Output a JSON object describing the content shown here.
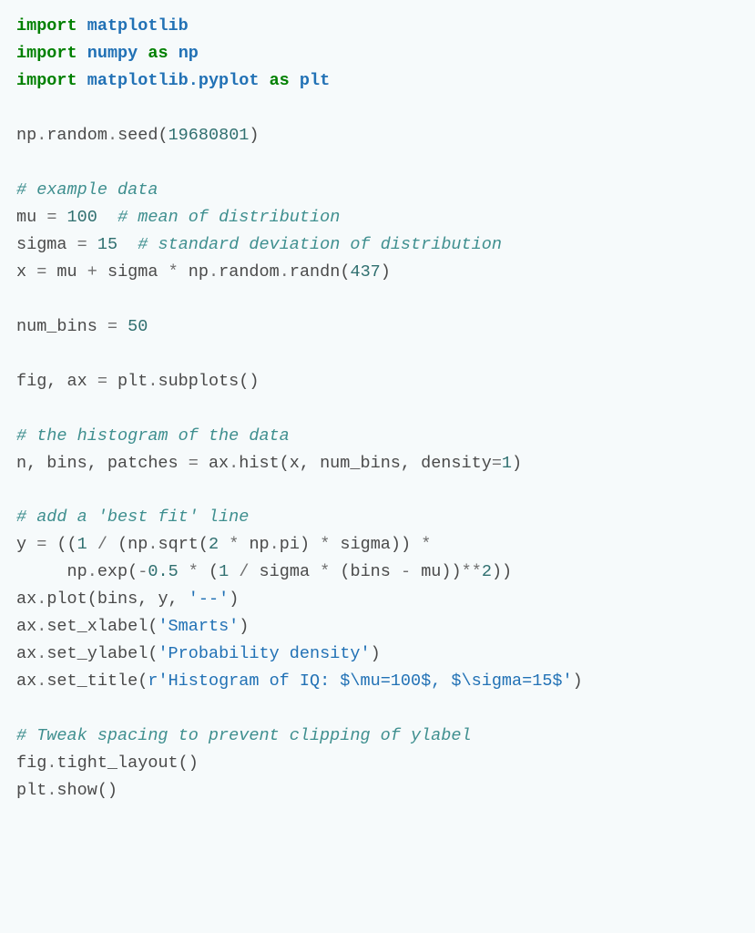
{
  "code": {
    "lines": [
      [
        {
          "t": "import",
          "c": "k"
        },
        {
          "t": " ",
          "c": "n"
        },
        {
          "t": "matplotlib",
          "c": "nn"
        }
      ],
      [
        {
          "t": "import",
          "c": "k"
        },
        {
          "t": " ",
          "c": "n"
        },
        {
          "t": "numpy",
          "c": "nn"
        },
        {
          "t": " ",
          "c": "n"
        },
        {
          "t": "as",
          "c": "k"
        },
        {
          "t": " ",
          "c": "n"
        },
        {
          "t": "np",
          "c": "nn"
        }
      ],
      [
        {
          "t": "import",
          "c": "k"
        },
        {
          "t": " ",
          "c": "n"
        },
        {
          "t": "matplotlib.pyplot",
          "c": "nn"
        },
        {
          "t": " ",
          "c": "n"
        },
        {
          "t": "as",
          "c": "k"
        },
        {
          "t": " ",
          "c": "n"
        },
        {
          "t": "plt",
          "c": "nn"
        }
      ],
      [],
      [
        {
          "t": "np",
          "c": "n"
        },
        {
          "t": ".",
          "c": "o"
        },
        {
          "t": "random",
          "c": "n"
        },
        {
          "t": ".",
          "c": "o"
        },
        {
          "t": "seed(",
          "c": "n"
        },
        {
          "t": "19680801",
          "c": "mi"
        },
        {
          "t": ")",
          "c": "n"
        }
      ],
      [],
      [
        {
          "t": "# example data",
          "c": "c"
        }
      ],
      [
        {
          "t": "mu ",
          "c": "n"
        },
        {
          "t": "=",
          "c": "o"
        },
        {
          "t": " ",
          "c": "n"
        },
        {
          "t": "100",
          "c": "mi"
        },
        {
          "t": "  ",
          "c": "n"
        },
        {
          "t": "# mean of distribution",
          "c": "c"
        }
      ],
      [
        {
          "t": "sigma ",
          "c": "n"
        },
        {
          "t": "=",
          "c": "o"
        },
        {
          "t": " ",
          "c": "n"
        },
        {
          "t": "15",
          "c": "mi"
        },
        {
          "t": "  ",
          "c": "n"
        },
        {
          "t": "# standard deviation of distribution",
          "c": "c"
        }
      ],
      [
        {
          "t": "x ",
          "c": "n"
        },
        {
          "t": "=",
          "c": "o"
        },
        {
          "t": " mu ",
          "c": "n"
        },
        {
          "t": "+",
          "c": "o"
        },
        {
          "t": " sigma ",
          "c": "n"
        },
        {
          "t": "*",
          "c": "o"
        },
        {
          "t": " np",
          "c": "n"
        },
        {
          "t": ".",
          "c": "o"
        },
        {
          "t": "random",
          "c": "n"
        },
        {
          "t": ".",
          "c": "o"
        },
        {
          "t": "randn(",
          "c": "n"
        },
        {
          "t": "437",
          "c": "mi"
        },
        {
          "t": ")",
          "c": "n"
        }
      ],
      [],
      [
        {
          "t": "num_bins ",
          "c": "n"
        },
        {
          "t": "=",
          "c": "o"
        },
        {
          "t": " ",
          "c": "n"
        },
        {
          "t": "50",
          "c": "mi"
        }
      ],
      [],
      [
        {
          "t": "fig, ax ",
          "c": "n"
        },
        {
          "t": "=",
          "c": "o"
        },
        {
          "t": " plt",
          "c": "n"
        },
        {
          "t": ".",
          "c": "o"
        },
        {
          "t": "subplots()",
          "c": "n"
        }
      ],
      [],
      [
        {
          "t": "# the histogram of the data",
          "c": "c"
        }
      ],
      [
        {
          "t": "n, bins, patches ",
          "c": "n"
        },
        {
          "t": "=",
          "c": "o"
        },
        {
          "t": " ax",
          "c": "n"
        },
        {
          "t": ".",
          "c": "o"
        },
        {
          "t": "hist(x, num_bins, density",
          "c": "n"
        },
        {
          "t": "=",
          "c": "o"
        },
        {
          "t": "1",
          "c": "mi"
        },
        {
          "t": ")",
          "c": "n"
        }
      ],
      [],
      [
        {
          "t": "# add a 'best fit' line",
          "c": "c"
        }
      ],
      [
        {
          "t": "y ",
          "c": "n"
        },
        {
          "t": "=",
          "c": "o"
        },
        {
          "t": " ((",
          "c": "n"
        },
        {
          "t": "1",
          "c": "mi"
        },
        {
          "t": " ",
          "c": "n"
        },
        {
          "t": "/",
          "c": "o"
        },
        {
          "t": " (np",
          "c": "n"
        },
        {
          "t": ".",
          "c": "o"
        },
        {
          "t": "sqrt(",
          "c": "n"
        },
        {
          "t": "2",
          "c": "mi"
        },
        {
          "t": " ",
          "c": "n"
        },
        {
          "t": "*",
          "c": "o"
        },
        {
          "t": " np",
          "c": "n"
        },
        {
          "t": ".",
          "c": "o"
        },
        {
          "t": "pi) ",
          "c": "n"
        },
        {
          "t": "*",
          "c": "o"
        },
        {
          "t": " sigma)) ",
          "c": "n"
        },
        {
          "t": "*",
          "c": "o"
        }
      ],
      [
        {
          "t": "     np",
          "c": "n"
        },
        {
          "t": ".",
          "c": "o"
        },
        {
          "t": "exp(",
          "c": "n"
        },
        {
          "t": "-",
          "c": "o"
        },
        {
          "t": "0.5",
          "c": "mf"
        },
        {
          "t": " ",
          "c": "n"
        },
        {
          "t": "*",
          "c": "o"
        },
        {
          "t": " (",
          "c": "n"
        },
        {
          "t": "1",
          "c": "mi"
        },
        {
          "t": " ",
          "c": "n"
        },
        {
          "t": "/",
          "c": "o"
        },
        {
          "t": " sigma ",
          "c": "n"
        },
        {
          "t": "*",
          "c": "o"
        },
        {
          "t": " (bins ",
          "c": "n"
        },
        {
          "t": "-",
          "c": "o"
        },
        {
          "t": " mu))",
          "c": "n"
        },
        {
          "t": "**",
          "c": "o"
        },
        {
          "t": "2",
          "c": "mi"
        },
        {
          "t": "))",
          "c": "n"
        }
      ],
      [
        {
          "t": "ax",
          "c": "n"
        },
        {
          "t": ".",
          "c": "o"
        },
        {
          "t": "plot(bins, y, ",
          "c": "n"
        },
        {
          "t": "'--'",
          "c": "s"
        },
        {
          "t": ")",
          "c": "n"
        }
      ],
      [
        {
          "t": "ax",
          "c": "n"
        },
        {
          "t": ".",
          "c": "o"
        },
        {
          "t": "set_xlabel(",
          "c": "n"
        },
        {
          "t": "'Smarts'",
          "c": "s"
        },
        {
          "t": ")",
          "c": "n"
        }
      ],
      [
        {
          "t": "ax",
          "c": "n"
        },
        {
          "t": ".",
          "c": "o"
        },
        {
          "t": "set_ylabel(",
          "c": "n"
        },
        {
          "t": "'Probability density'",
          "c": "s"
        },
        {
          "t": ")",
          "c": "n"
        }
      ],
      [
        {
          "t": "ax",
          "c": "n"
        },
        {
          "t": ".",
          "c": "o"
        },
        {
          "t": "set_title(",
          "c": "n"
        },
        {
          "t": "r'Histogram of IQ: $\\mu=100$, $\\sigma=15$'",
          "c": "s"
        },
        {
          "t": ")",
          "c": "n"
        }
      ],
      [],
      [
        {
          "t": "# Tweak spacing to prevent clipping of ylabel",
          "c": "c"
        }
      ],
      [
        {
          "t": "fig",
          "c": "n"
        },
        {
          "t": ".",
          "c": "o"
        },
        {
          "t": "tight_layout()",
          "c": "n"
        }
      ],
      [
        {
          "t": "plt",
          "c": "n"
        },
        {
          "t": ".",
          "c": "o"
        },
        {
          "t": "show()",
          "c": "n"
        }
      ]
    ]
  }
}
